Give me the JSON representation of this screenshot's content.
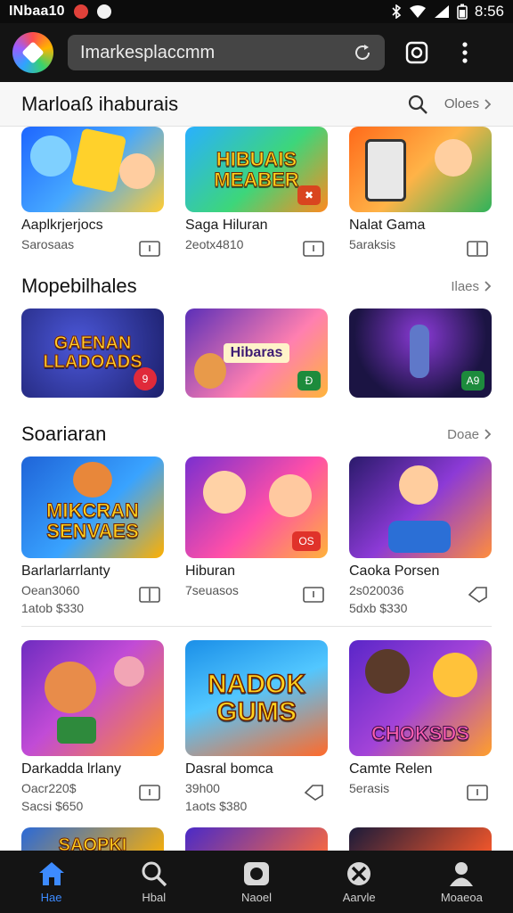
{
  "status_bar": {
    "carrier": "INbaa10",
    "time": "8:56"
  },
  "app_bar": {
    "url": "Imarkesplaccmm"
  },
  "top_header": {
    "title": "Marloaß ihaburais",
    "more_label": "Oloes"
  },
  "row1": [
    {
      "name": "Aaplkrjerjocs",
      "sub": "Sarosaas",
      "art": "",
      "colors": [
        "#2b7bff",
        "#ffcc33"
      ]
    },
    {
      "name": "Saga Hiluran",
      "sub": "2eotx4810",
      "art": "HIBUAIS MEABER",
      "colors": [
        "#2aa9ff",
        "#ff8a1f"
      ]
    },
    {
      "name": "Nalat Gama",
      "sub": "5araksis",
      "art": "",
      "colors": [
        "#ff7a1a",
        "#3dbb57"
      ]
    }
  ],
  "section2": {
    "title": "Mopebilhales",
    "more_label": "Ilaes"
  },
  "row2": [
    {
      "name": "",
      "art": "GAENAN LLADOADS",
      "badge": "9",
      "colors": [
        "#1f2c8f",
        "#e8408c"
      ]
    },
    {
      "name": "",
      "art": "Hibaras",
      "badge": "Ð",
      "colors": [
        "#7a3cc9",
        "#ff9a2b"
      ]
    },
    {
      "name": "",
      "art": "",
      "badge": "A9",
      "colors": [
        "#2a1f6b",
        "#d84bd6"
      ]
    }
  ],
  "section3": {
    "title": "Soariaran",
    "more_label": "Doae"
  },
  "row3": [
    {
      "name": "Barlarlarrlanty",
      "sub": "Oean3060",
      "sub2": "1atob $330",
      "art": "MIKCRAN SENVAES",
      "colors": [
        "#2b7de0",
        "#ffb000"
      ]
    },
    {
      "name": "Hiburan",
      "sub": "7seuasos",
      "sub2": "",
      "art": "",
      "colors": [
        "#8f3bd6",
        "#ff5ea8"
      ]
    },
    {
      "name": "Caoka Porsen",
      "sub": "2s020036",
      "sub2": "5dxb $330",
      "art": "",
      "colors": [
        "#3a1f7a",
        "#ff8d3c"
      ]
    }
  ],
  "row4": [
    {
      "name": "Darkadda lrlany",
      "sub": "Oacr220$",
      "sub2": "Sacsi $650",
      "art": "",
      "colors": [
        "#7b2fc0",
        "#ff8a2b"
      ]
    },
    {
      "name": "Dasral bomca",
      "sub": "39h00",
      "sub2": "1aots $380",
      "art": "NADOK GUMS",
      "colors": [
        "#1e8fe8",
        "#ff6a2a"
      ]
    },
    {
      "name": "Camte Relen",
      "sub": "5erasis",
      "sub2": "",
      "art": "CHOKSDS",
      "colors": [
        "#6a2bcf",
        "#ff9f2b"
      ]
    }
  ],
  "row5": [
    {
      "art": "SAOPKI",
      "colors": [
        "#2a69d8",
        "#ffb100"
      ]
    },
    {
      "art": "",
      "colors": [
        "#4a2ac8",
        "#ff6b3a"
      ]
    },
    {
      "art": "",
      "colors": [
        "#1b1b3a",
        "#ff5a2a"
      ]
    }
  ],
  "bottom_nav": [
    {
      "label": "Hae",
      "icon": "home-icon",
      "active": true
    },
    {
      "label": "Hbal",
      "icon": "search-icon",
      "active": false
    },
    {
      "label": "Naoel",
      "icon": "library-icon",
      "active": false
    },
    {
      "label": "Aarvle",
      "icon": "tools-icon",
      "active": false
    },
    {
      "label": "Moaeoa",
      "icon": "profile-icon",
      "active": false
    }
  ],
  "colors": {
    "accent": "#3d8bff",
    "bar_bg": "#141414"
  }
}
